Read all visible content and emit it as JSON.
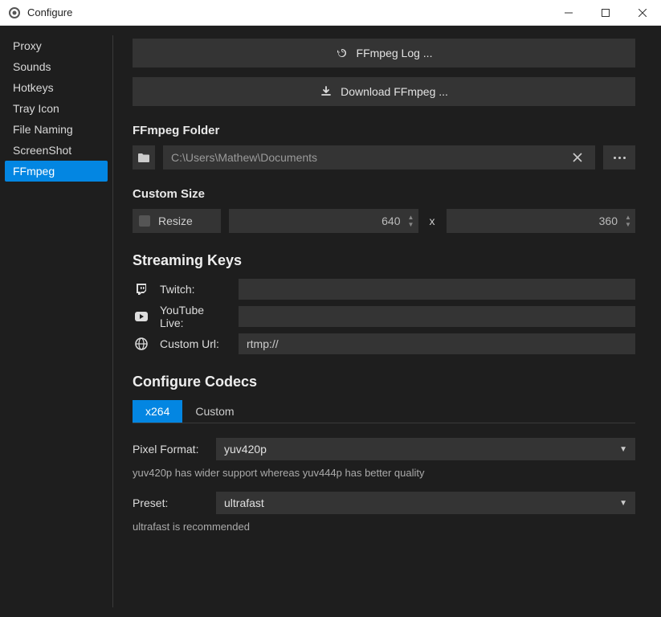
{
  "window": {
    "title": "Configure"
  },
  "sidebar": {
    "items": [
      {
        "label": "Proxy"
      },
      {
        "label": "Sounds"
      },
      {
        "label": "Hotkeys"
      },
      {
        "label": "Tray Icon"
      },
      {
        "label": "File Naming"
      },
      {
        "label": "ScreenShot"
      },
      {
        "label": "FFmpeg"
      }
    ],
    "activeIndex": 6
  },
  "buttons": {
    "log": "FFmpeg Log ...",
    "download": "Download FFmpeg ..."
  },
  "folder": {
    "section": "FFmpeg Folder",
    "path": "C:\\Users\\Mathew\\Documents"
  },
  "customSize": {
    "section": "Custom Size",
    "resizeLabel": "Resize",
    "width": "640",
    "height": "360",
    "sep": "x"
  },
  "streaming": {
    "section": "Streaming Keys",
    "rows": [
      {
        "icon": "twitch",
        "label": "Twitch:",
        "value": ""
      },
      {
        "icon": "youtube",
        "label": "YouTube Live:",
        "value": ""
      },
      {
        "icon": "globe",
        "label": "Custom Url:",
        "value": "rtmp://"
      }
    ]
  },
  "codecs": {
    "section": "Configure Codecs",
    "tabs": [
      {
        "label": "x264"
      },
      {
        "label": "Custom"
      }
    ],
    "activeTab": 0,
    "pixelFormat": {
      "label": "Pixel Format:",
      "value": "yuv420p",
      "help": "yuv420p has wider support whereas yuv444p has better quality"
    },
    "preset": {
      "label": "Preset:",
      "value": "ultrafast",
      "help": "ultrafast is recommended"
    }
  }
}
